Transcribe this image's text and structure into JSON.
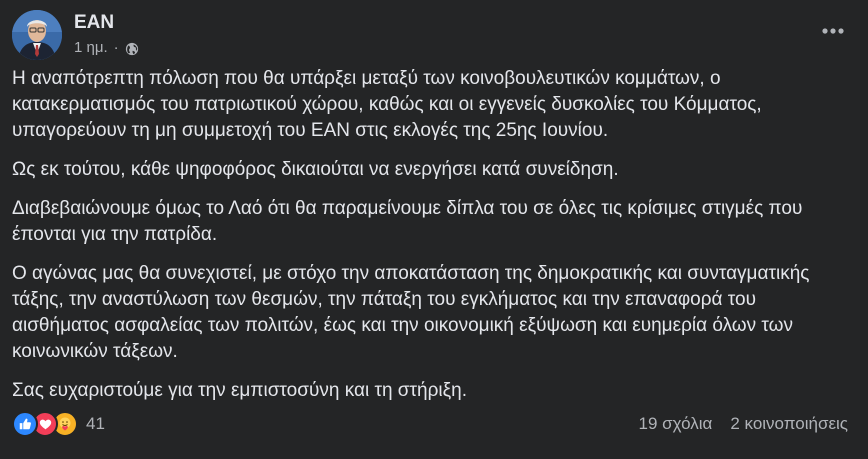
{
  "post": {
    "author": "ΕΑΝ",
    "time": "1 ημ.",
    "separator": "·",
    "paragraphs": [
      "Η αναπότρεπτη πόλωση που θα υπάρξει μεταξύ των κοινοβουλευτικών κομμάτων, ο κατακερματισμός του πατριωτικού χώρου, καθώς και οι εγγενείς δυσκολίες του Κόμματος, υπαγορεύουν τη μη συμμετοχή του ΕΑΝ στις εκλογές της 25ης Ιουνίου.",
      "Ως εκ τούτου, κάθε ψηφοφόρος δικαιούται να ενεργήσει κατά συνείδηση.",
      "Διαβεβαιώνουμε όμως το Λαό ότι θα παραμείνουμε δίπλα του σε όλες τις κρίσιμες στιγμές που έπονται για την πατρίδα.",
      "Ο αγώνας μας θα συνεχιστεί, με στόχο την αποκατάσταση της δημοκρατικής και συνταγματικής τάξης, την αναστύλωση των θεσμών, την πάταξη του εγκλήματος και την επαναφορά του αισθήματος ασφαλείας των πολιτών, έως και την οικονομική εξύψωση και ευημερία όλων των κοινωνικών τάξεων.",
      "Σας ευχαριστούμε για την εμπιστοσύνη και τη στήριξη."
    ]
  },
  "footer": {
    "reactions": [
      "like-icon",
      "love-icon",
      "care-icon"
    ],
    "reaction_count": "41",
    "comments": "19 σχόλια",
    "shares": "2 κοινοποιήσεις"
  },
  "icons": {
    "globe": "globe-icon",
    "more": "more-options-icon"
  },
  "colors": {
    "background": "#242526",
    "text": "#e4e6eb",
    "secondary_text": "#b0b3b8",
    "like": "#2d88ff",
    "love": "#f33e58",
    "care": "#f7b125"
  }
}
